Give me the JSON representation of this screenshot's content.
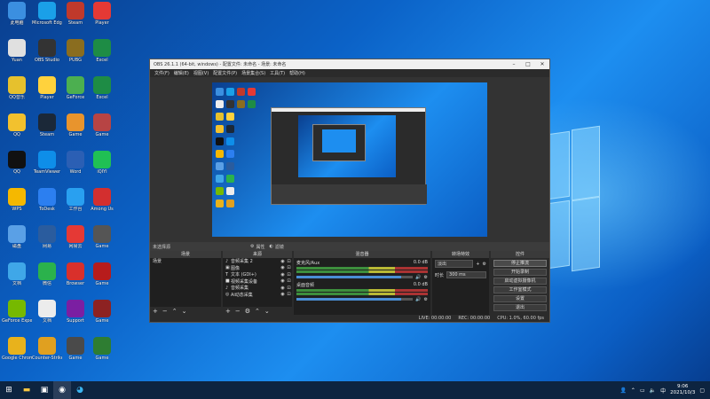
{
  "desktop": {
    "icons": [
      {
        "label": "此电脑",
        "color": "#3b8fe0",
        "col": 0,
        "row": 0
      },
      {
        "label": "Microsoft Edge",
        "color": "#1aa0e8",
        "col": 1,
        "row": 0
      },
      {
        "label": "Steam",
        "color": "#c0392b",
        "col": 2,
        "row": 0
      },
      {
        "label": "Player",
        "color": "#e53935",
        "col": 3,
        "row": 0
      },
      {
        "label": "Yuan",
        "color": "#e0e0e0",
        "col": 0,
        "row": 1
      },
      {
        "label": "OBS Studio",
        "color": "#333333",
        "col": 1,
        "row": 1
      },
      {
        "label": "PUBG",
        "color": "#8a6d1f",
        "col": 2,
        "row": 1
      },
      {
        "label": "Excel",
        "color": "#1e8c45",
        "col": 3,
        "row": 1
      },
      {
        "label": "QQ音乐",
        "color": "#e6c12d",
        "col": 0,
        "row": 2
      },
      {
        "label": "Player",
        "color": "#ffd23d",
        "col": 1,
        "row": 2
      },
      {
        "label": "GeForce",
        "color": "#4caf50",
        "col": 2,
        "row": 2
      },
      {
        "label": "Excel",
        "color": "#1e8c45",
        "col": 3,
        "row": 2
      },
      {
        "label": "QQ",
        "color": "#f2c12e",
        "col": 0,
        "row": 3
      },
      {
        "label": "Steam",
        "color": "#1b2838",
        "col": 1,
        "row": 3
      },
      {
        "label": "Game",
        "color": "#e8942d",
        "col": 2,
        "row": 3
      },
      {
        "label": "Game",
        "color": "#b74444",
        "col": 3,
        "row": 3
      },
      {
        "label": "QQ",
        "color": "#111111",
        "col": 0,
        "row": 4
      },
      {
        "label": "TeamViewer",
        "color": "#0e8ee9",
        "col": 1,
        "row": 4
      },
      {
        "label": "Word",
        "color": "#2b5fb4",
        "col": 2,
        "row": 4
      },
      {
        "label": "iQIYI",
        "color": "#20c054",
        "col": 3,
        "row": 4
      },
      {
        "label": "WPS",
        "color": "#f5b800",
        "col": 0,
        "row": 5
      },
      {
        "label": "ToDesk",
        "color": "#2c7ff0",
        "col": 1,
        "row": 5
      },
      {
        "label": "工作台",
        "color": "#29a0f0",
        "col": 2,
        "row": 5
      },
      {
        "label": "Among Us",
        "color": "#d32f2f",
        "col": 3,
        "row": 5
      },
      {
        "label": "磁盘",
        "color": "#5aa0e6",
        "col": 0,
        "row": 6
      },
      {
        "label": "网易",
        "color": "#2a5c9e",
        "col": 1,
        "row": 6
      },
      {
        "label": "网易云",
        "color": "#e53935",
        "col": 2,
        "row": 6
      },
      {
        "label": "Game",
        "color": "#555555",
        "col": 3,
        "row": 6
      },
      {
        "label": "文档",
        "color": "#3fa7e8",
        "col": 0,
        "row": 7
      },
      {
        "label": "微信",
        "color": "#2bb24c",
        "col": 1,
        "row": 7
      },
      {
        "label": "Browser",
        "color": "#d9302b",
        "col": 2,
        "row": 7
      },
      {
        "label": "Game",
        "color": "#b71c1c",
        "col": 3,
        "row": 7
      },
      {
        "label": "GeForce Experience",
        "color": "#76b900",
        "col": 0,
        "row": 8
      },
      {
        "label": "文档",
        "color": "#ececec",
        "col": 1,
        "row": 8
      },
      {
        "label": "Support",
        "color": "#7b1fa2",
        "col": 2,
        "row": 8
      },
      {
        "label": "Game",
        "color": "#8d2222",
        "col": 3,
        "row": 8
      },
      {
        "label": "Google Chrome",
        "color": "#e8b21c",
        "col": 0,
        "row": 9
      },
      {
        "label": "Counter-Strike",
        "color": "#e0a020",
        "col": 1,
        "row": 9
      },
      {
        "label": "Game",
        "color": "#4a4a4a",
        "col": 2,
        "row": 9
      },
      {
        "label": "Game",
        "color": "#2e7d32",
        "col": 3,
        "row": 9
      }
    ]
  },
  "obs": {
    "title": "OBS 26.1.1 (64-bit, windows) - 配置文件: 未命名 - 场景: 未命名",
    "menu": [
      "文件(F)",
      "编辑(E)",
      "视图(V)",
      "配置文件(P)",
      "场景集合(S)",
      "工具(T)",
      "帮助(H)"
    ],
    "no_source_label": "未选择源",
    "scene_tools": [
      "属性",
      "滤镜"
    ],
    "panels": {
      "scenes": {
        "title": "场景",
        "items": [
          "场景"
        ]
      },
      "sources": {
        "title": "来源",
        "items": [
          {
            "name": "音频采集 2",
            "icon": "♪"
          },
          {
            "name": "图像",
            "icon": "▣"
          },
          {
            "name": "文本 (GDI+)",
            "icon": "T"
          },
          {
            "name": "视频采集设备",
            "icon": "■"
          },
          {
            "name": "音频采集",
            "icon": "♪"
          },
          {
            "name": "Ai动态采集",
            "icon": "◎"
          }
        ]
      },
      "mixer": {
        "title": "混音器",
        "channels": [
          {
            "name": "麦克风/Aux",
            "db": "0.0 dB"
          },
          {
            "name": "桌面音频",
            "db": "0.0 dB"
          }
        ]
      },
      "transitions": {
        "title": "转场特效",
        "type": "淡出",
        "duration_label": "时长",
        "duration": "300 ms"
      },
      "controls": {
        "title": "控件",
        "buttons": [
          "停止推流",
          "开始录制",
          "启动虚拟摄像机",
          "工作室模式",
          "设置",
          "退出"
        ]
      }
    },
    "status": {
      "live": "LIVE: 00:00:00",
      "rec": "REC: 00:00:00",
      "cpu": "CPU: 1.0%, 60.00 fps"
    }
  },
  "taskbar": {
    "time": "9:06",
    "date": "2021/10/3",
    "lang": "中"
  }
}
